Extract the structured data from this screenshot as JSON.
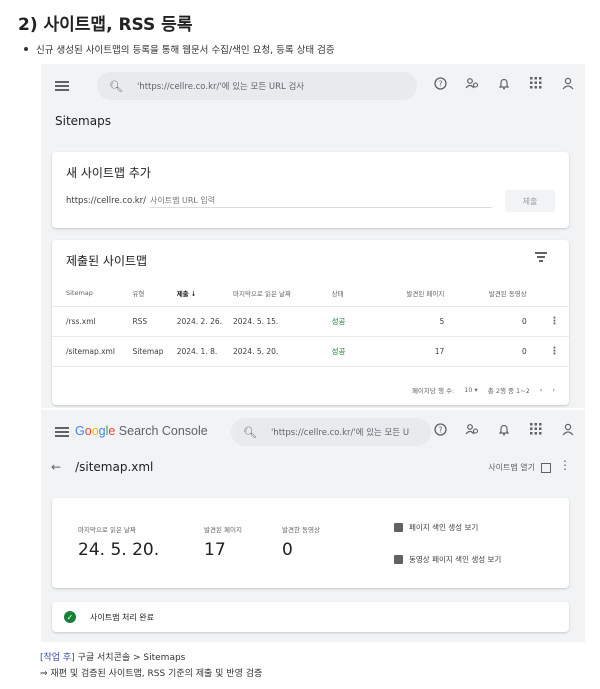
{
  "heading": "2) 사이트맵, RSS 등록",
  "bullet": "신규 생성된 사이트맵의 등록을 통해 웹문서 수집/색인 요청, 등록 상태 검증",
  "console1": {
    "search_placeholder": "'https://cellre.co.kr/'에 있는 모든 URL 검사",
    "page_title": "Sitemaps",
    "add_card": {
      "title": "새 사이트맵 추가",
      "prefix": "https://cellre.co.kr/",
      "input_placeholder": "사이트맵 URL 입력",
      "submit_label": "제출"
    },
    "list_card": {
      "title": "제출된 사이트맵",
      "columns": [
        "Sitemap",
        "유형",
        "제출 ↓",
        "마지막으로 읽은 날짜",
        "상태",
        "발견된 페이지",
        "발견된 동영상"
      ],
      "rows": [
        {
          "sitemap": "/rss.xml",
          "type": "RSS",
          "submitted": "2024. 2. 26.",
          "last_read": "2024. 5. 15.",
          "status": "성공",
          "pages": "5",
          "videos": "0"
        },
        {
          "sitemap": "/sitemap.xml",
          "type": "Sitemap",
          "submitted": "2024. 1. 8.",
          "last_read": "2024. 5. 20.",
          "status": "성공",
          "pages": "17",
          "videos": "0"
        }
      ],
      "pager": {
        "rows_label": "페이지당 행 수:",
        "rows_value": "10",
        "range": "총 2행 중 1~2"
      }
    }
  },
  "console2": {
    "logo": {
      "g": "G",
      "o1": "o",
      "o2": "o",
      "g2": "g",
      "l": "l",
      "e": "e",
      "rest": " Search Console"
    },
    "search_placeholder": "'https://cellre.co.kr/'에 있는 모든 U",
    "crumb": "/sitemap.xml",
    "open_label": "사이트맵 열기",
    "stats": [
      {
        "label": "마지막으로 읽은 날짜",
        "value": "24. 5. 20."
      },
      {
        "label": "발견된 페이지",
        "value": "17"
      },
      {
        "label": "발견한 동영상",
        "value": "0"
      }
    ],
    "reports": [
      "페이지 색인 생성 보기",
      "동영상 페이지 색인 생성 보기"
    ],
    "done": "사이트맵 처리 완료"
  },
  "note": {
    "tag": "[작업 후]",
    "line1": " 구글 서치콘솔 > Sitemaps",
    "line2": "⇒ 재편 및 검증된 사이트맵, RSS 기준의 제출 및 반영 검증"
  }
}
